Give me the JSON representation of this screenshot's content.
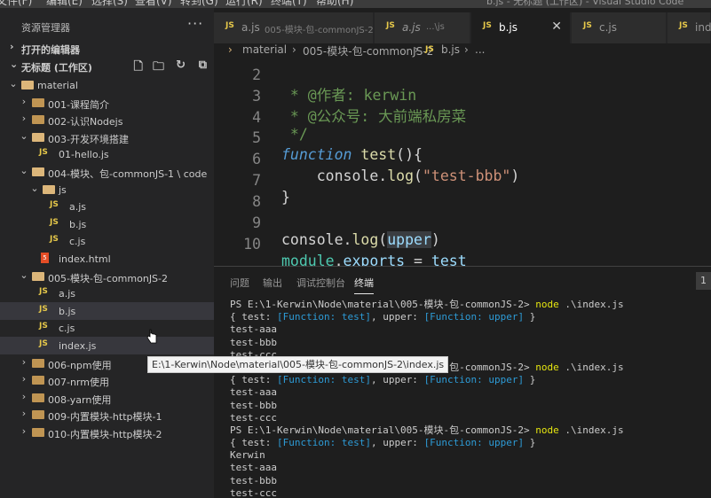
{
  "menu": {
    "items": [
      "文件(F)",
      "编辑(E)",
      "选择(S)",
      "查看(V)",
      "转到(G)",
      "运行(R)",
      "终端(T)",
      "帮助(H)"
    ],
    "window_title": "b.js - 无标题 (工作区) - Visual Studio Code"
  },
  "explorer": {
    "title": "资源管理器",
    "more_icon": "ellipsis-icon",
    "open_editors_label": "打开的编辑器",
    "workspace_label": "无标题 (工作区)",
    "tree": [
      {
        "label": "material",
        "kind": "folder-open",
        "depth": 1
      },
      {
        "label": "001-课程简介",
        "kind": "folder",
        "depth": 2
      },
      {
        "label": "002-认识Nodejs",
        "kind": "folder",
        "depth": 2
      },
      {
        "label": "003-开发环境搭建",
        "kind": "folder-open",
        "depth": 2
      },
      {
        "label": "01-hello.js",
        "kind": "js",
        "depth": 3
      },
      {
        "label": "004-模块、包-commonJS-1 \\ code",
        "kind": "folder-open",
        "depth": 2
      },
      {
        "label": "js",
        "kind": "folder-open",
        "depth": 3
      },
      {
        "label": "a.js",
        "kind": "js",
        "depth": 4
      },
      {
        "label": "b.js",
        "kind": "js",
        "depth": 4
      },
      {
        "label": "c.js",
        "kind": "js",
        "depth": 4
      },
      {
        "label": "index.html",
        "kind": "html",
        "depth": 3
      },
      {
        "label": "005-模块-包-commonJS-2",
        "kind": "folder-open",
        "depth": 2
      },
      {
        "label": "a.js",
        "kind": "js",
        "depth": 3
      },
      {
        "label": "b.js",
        "kind": "js",
        "depth": 3
      },
      {
        "label": "c.js",
        "kind": "js",
        "depth": 3
      },
      {
        "label": "index.js",
        "kind": "js",
        "depth": 3
      },
      {
        "label": "006-npm使用",
        "kind": "folder",
        "depth": 2
      },
      {
        "label": "007-nrm使用",
        "kind": "folder",
        "depth": 2
      },
      {
        "label": "008-yarn使用",
        "kind": "folder",
        "depth": 2
      },
      {
        "label": "009-内置模块-http模块-1",
        "kind": "folder",
        "depth": 2
      },
      {
        "label": "010-内置模块-http模块-2",
        "kind": "folder",
        "depth": 2
      }
    ]
  },
  "tabs": [
    {
      "name": "a.js",
      "desc": "005-模块-包-commonJS-2",
      "active": false
    },
    {
      "name": "a.js",
      "desc": "...\\js",
      "active": false,
      "italic": true
    },
    {
      "name": "b.js",
      "desc": "",
      "active": true
    },
    {
      "name": "c.js",
      "desc": "",
      "active": false
    },
    {
      "name": "inde",
      "desc": "",
      "active": false
    }
  ],
  "breadcrumb": [
    "material",
    "005-模块-包-commonJS-2",
    "b.js",
    "..."
  ],
  "editor": {
    "lines": [
      {
        "n": "2",
        "text": " * @作者: kerwin"
      },
      {
        "n": "3",
        "text": " * @公众号: 大前端私房菜"
      },
      {
        "n": "4",
        "text": " */"
      },
      {
        "n": "5",
        "text": "function test(){"
      },
      {
        "n": "6",
        "text": "    console.log(\"test-bbb\")"
      },
      {
        "n": "7",
        "text": "}"
      },
      {
        "n": "8",
        "text": ""
      },
      {
        "n": "9",
        "text": "console.log(upper)"
      },
      {
        "n": "10",
        "text": "module.exports = test"
      }
    ]
  },
  "panel": {
    "tabs": [
      "问题",
      "输出",
      "调试控制台",
      "终端"
    ],
    "active_tab": "终端",
    "right_badge": "1",
    "terminal": [
      "PS E:\\1-Kerwin\\Node\\material\\005-模块-包-commonJS-2> node .\\index.js",
      "{ test: [Function: test], upper: [Function: upper] }",
      "test-aaa",
      "test-bbb",
      "test-ccc",
      "PS E:\\1-Kerwin\\Node\\material\\005-模块-包-commonJS-2> node .\\index.js",
      "{ test: [Function: test], upper: [Function: upper] }",
      "test-aaa",
      "test-bbb",
      "test-ccc",
      "PS E:\\1-Kerwin\\Node\\material\\005-模块-包-commonJS-2> node .\\index.js",
      "{ test: [Function: test], upper: [Function: upper] }",
      "Kerwin",
      "test-aaa",
      "test-bbb",
      "test-ccc"
    ]
  },
  "tooltip": "E:\\1-Kerwin\\Node\\material\\005-模块-包-commonJS-2\\index.js"
}
